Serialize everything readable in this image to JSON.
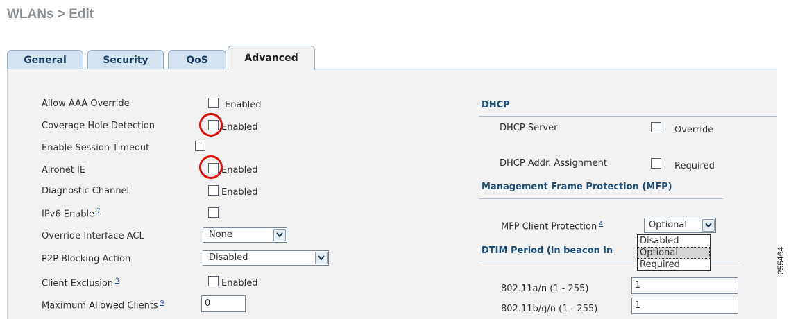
{
  "page": {
    "title": "WLANs > Edit"
  },
  "tabs": [
    "General",
    "Security",
    "QoS",
    "Advanced"
  ],
  "active_tab": "Advanced",
  "left": {
    "allow_aaa_override": {
      "label": "Allow AAA Override",
      "cb_label": "Enabled",
      "checked": false
    },
    "coverage_hole": {
      "label": "Coverage Hole Detection",
      "cb_label": "Enabled",
      "checked": false
    },
    "session_timeout": {
      "label": "Enable Session Timeout",
      "checked": false
    },
    "aironet_ie": {
      "label": "Aironet IE",
      "cb_label": "Enabled",
      "checked": false
    },
    "diagnostic_channel": {
      "label": "Diagnostic Channel",
      "cb_label": "Enabled",
      "checked": false
    },
    "ipv6": {
      "label": "IPv6 Enable",
      "footnote": "7",
      "checked": false
    },
    "override_acl": {
      "label": "Override Interface ACL",
      "value": "None"
    },
    "p2p_blocking": {
      "label": "P2P Blocking Action",
      "value": "Disabled"
    },
    "client_exclusion": {
      "label": "Client Exclusion",
      "footnote": "3",
      "cb_label": "Enabled",
      "checked": false
    },
    "max_clients": {
      "label": "Maximum Allowed Clients",
      "footnote": "9",
      "value": "0"
    }
  },
  "right": {
    "dhcp": {
      "heading": "DHCP",
      "server": {
        "label": "DHCP Server",
        "cb_label": "Override",
        "checked": false
      },
      "addr_assignment": {
        "label": "DHCP Addr. Assignment",
        "cb_label": "Required",
        "checked": false
      }
    },
    "mfp": {
      "heading": "Management Frame Protection (MFP)",
      "client_protection": {
        "label": "MFP Client Protection",
        "footnote": "4",
        "value": "Optional"
      },
      "options": [
        "Disabled",
        "Optional",
        "Required"
      ]
    },
    "dtim": {
      "heading": "DTIM Period (in beacon in",
      "a_n": {
        "label": "802.11a/n (1 - 255)",
        "value": "1"
      },
      "b_g_n": {
        "label": "802.11b/g/n (1 - 255)",
        "value": "1"
      }
    }
  },
  "figure_id": "255464"
}
